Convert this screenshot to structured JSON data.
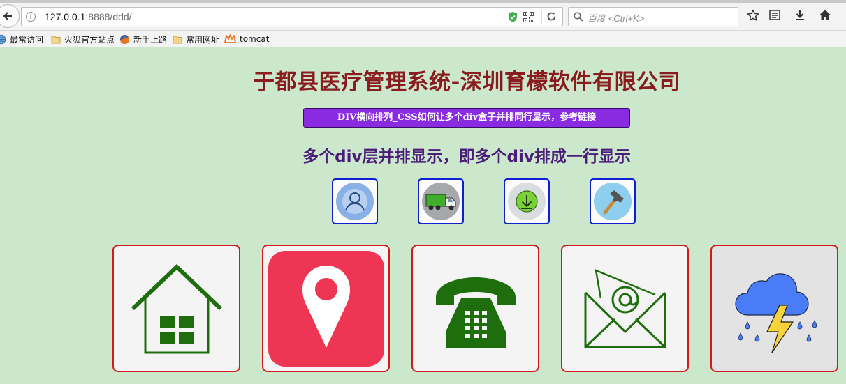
{
  "browser": {
    "url_host": "127.0.0.1",
    "url_rest": ":8888/ddd/",
    "search_placeholder": "百度 <Ctrl+K>",
    "bookmarks": [
      "最常访问",
      "火狐官方站点",
      "新手上路",
      "常用网址",
      "tomcat"
    ]
  },
  "page": {
    "title": "于都县医疗管理系统-深圳育檬软件有限公司",
    "link_button": "DIV横向排列_CSS如何让多个div盒子并排同行显示，参考链接",
    "subtitle": "多个div层并排显示，即多个div排成一行显示"
  },
  "small_icons": [
    "user-icon",
    "truck-icon",
    "download-icon",
    "hammer-icon"
  ],
  "large_icons": [
    "home-icon",
    "location-pin-icon",
    "telephone-icon",
    "email-icon",
    "storm-icon"
  ],
  "colors": {
    "page_background": "#cce8cc",
    "title": "#8a1c20",
    "subtitle": "#4b1c7a",
    "link_button_bg": "#8a2be2",
    "small_box_border": "#1020d0",
    "large_box_border": "#d21a1a",
    "icon_green": "#1e6e0e",
    "pin_red": "#ee3553"
  }
}
